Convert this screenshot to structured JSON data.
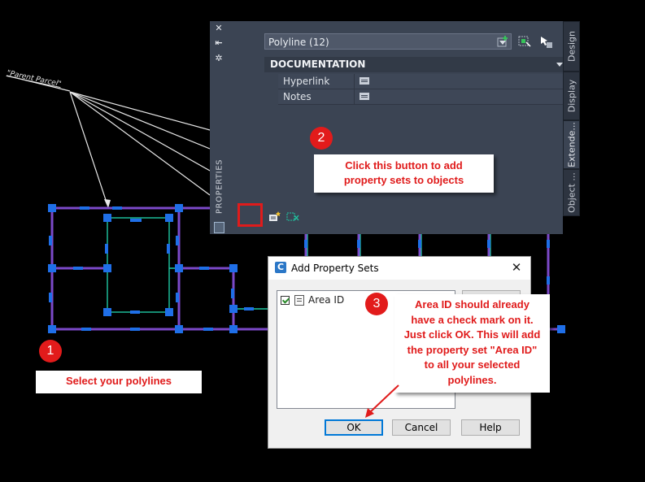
{
  "palette": {
    "object_selector": "Polyline (12)",
    "strip_label": "PROPERTIES",
    "section_header": "DOCUMENTATION",
    "rows": [
      {
        "label": "Hyperlink"
      },
      {
        "label": "Notes"
      }
    ],
    "tabs": [
      "Design",
      "Display",
      "Extende...",
      "Object ..."
    ],
    "strip_icons": [
      "close-icon",
      "pin-icon",
      "settings-icon"
    ],
    "accent_highlight": "#e01b1b"
  },
  "dialog": {
    "title": "Add Property Sets",
    "list_items": [
      {
        "name": "Area ID",
        "checked": true
      }
    ],
    "buttons": {
      "ok": "OK",
      "cancel": "Cancel",
      "help": "Help"
    }
  },
  "drawing": {
    "parent_label": "\"Parent Parcel\""
  },
  "callouts": {
    "step1": {
      "number": "1",
      "text": "Select your polylines"
    },
    "step2": {
      "number": "2",
      "line1": "Click this button to add",
      "line2": "property sets to objects"
    },
    "step3": {
      "number": "3",
      "lines": [
        "Area ID should already",
        "have a check mark on it.",
        "Just click OK. This will add",
        "the property set \"Area ID\"",
        "to all your selected",
        "polylines."
      ]
    }
  }
}
